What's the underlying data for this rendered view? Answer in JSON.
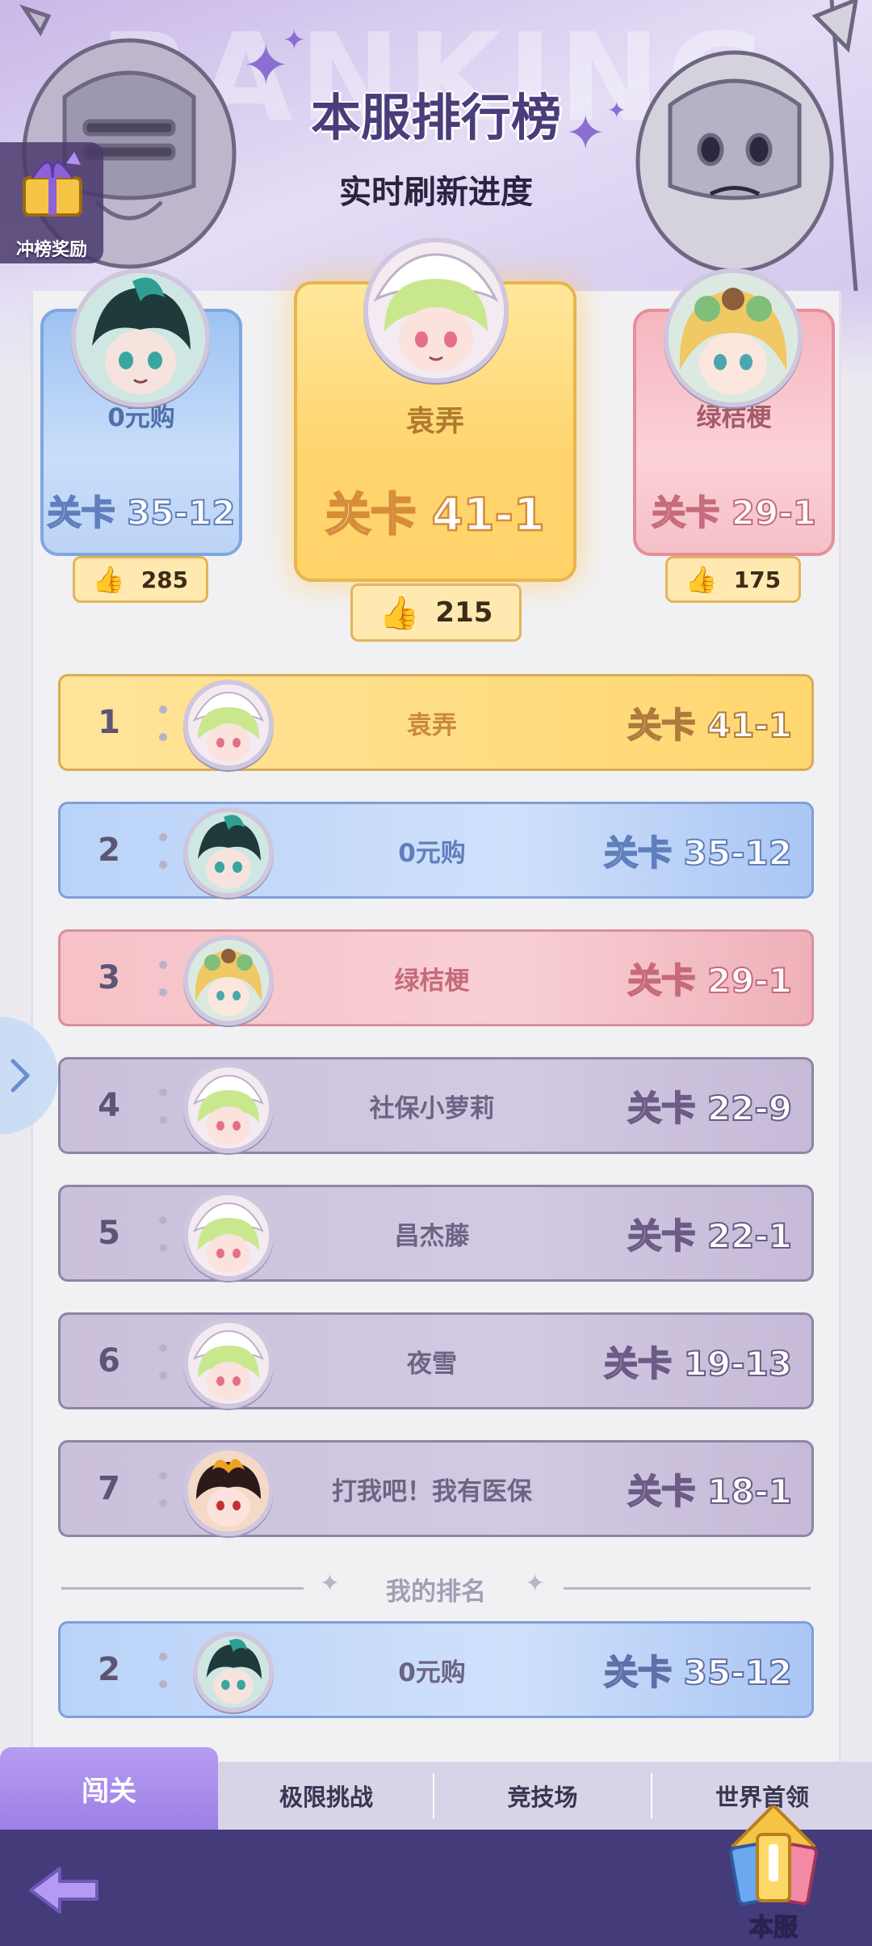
{
  "header": {
    "watermark": "RANKING",
    "title": "本服排行榜",
    "subtitle": "实时刷新进度",
    "reward_label": "冲榜奖励"
  },
  "podium": {
    "first": {
      "name": "袁弄",
      "stage": "关卡 41-1",
      "likes": "215"
    },
    "second": {
      "name": "0元购",
      "stage": "关卡 35-12",
      "likes": "285"
    },
    "third": {
      "name": "绿桔梗",
      "stage": "关卡 29-1",
      "likes": "175"
    }
  },
  "rows": [
    {
      "rank": "1",
      "name": "袁弄",
      "stage": "关卡 41-1",
      "avatar": "green-hair-maid-avatar"
    },
    {
      "rank": "2",
      "name": "0元购",
      "stage": "关卡 35-12",
      "avatar": "dark-teal-hair-avatar"
    },
    {
      "rank": "3",
      "name": "绿桔梗",
      "stage": "关卡 29-1",
      "avatar": "blonde-flower-crown-avatar"
    },
    {
      "rank": "4",
      "name": "社保小萝莉",
      "stage": "关卡 22-9",
      "avatar": "green-hair-maid-avatar"
    },
    {
      "rank": "5",
      "name": "昌杰藤",
      "stage": "关卡 22-1",
      "avatar": "green-hair-maid-avatar"
    },
    {
      "rank": "6",
      "name": "夜雪",
      "stage": "关卡 19-13",
      "avatar": "green-hair-maid-avatar"
    },
    {
      "rank": "7",
      "name": "打我吧！我有医保",
      "stage": "关卡 18-1",
      "avatar": "fire-hair-avatar"
    }
  ],
  "my_rank": {
    "label": "我的排名",
    "rank": "2",
    "name": "0元购",
    "stage": "关卡 35-12"
  },
  "tabs": [
    {
      "label": "闯关",
      "active": true
    },
    {
      "label": "极限挑战",
      "active": false
    },
    {
      "label": "竞技场",
      "active": false
    },
    {
      "label": "世界首领",
      "active": false
    }
  ],
  "bottom": {
    "server_label": "本服"
  },
  "colors": {
    "gold": "#ffd770",
    "blue": "#b9d3f8",
    "pink": "#f6c1c7",
    "purple": "#cbc0dc",
    "tab_active": "#9c80e6",
    "bottom_bar": "#433b7a"
  }
}
